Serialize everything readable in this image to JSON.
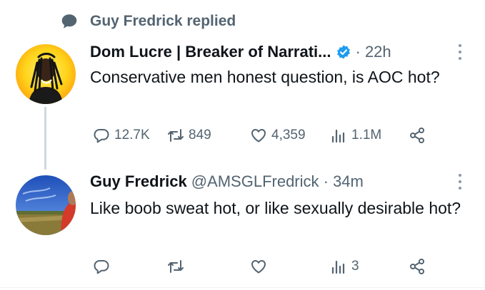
{
  "reply_context": {
    "text": "Guy Fredrick replied",
    "icon": "speech-bubble-icon"
  },
  "tweets": [
    {
      "author": "Dom Lucre | Breaker of Narrati...",
      "verified": true,
      "meta": "· 22h",
      "text": "Conservative men honest question, is AOC hot?",
      "stats": {
        "replies": "12.7K",
        "retweets": "849",
        "likes": "4,359",
        "views": "1.1M"
      }
    },
    {
      "author": "Guy Fredrick",
      "verified": false,
      "meta": "@AMSGLFredrick · 34m",
      "text": "Like boob sweat hot, or like sexually desirable hot?",
      "stats": {
        "replies": "",
        "retweets": "",
        "likes": "",
        "views": "3"
      }
    }
  ],
  "colors": {
    "accent": "#1d9bf0",
    "secondary_text": "#536471",
    "primary_text": "#0f1419",
    "thread_line": "#cfd9de"
  },
  "icons": [
    "speech-bubble-icon",
    "verified-badge-icon",
    "more-icon",
    "reply-icon",
    "retweet-icon",
    "like-icon",
    "views-icon",
    "share-icon"
  ]
}
